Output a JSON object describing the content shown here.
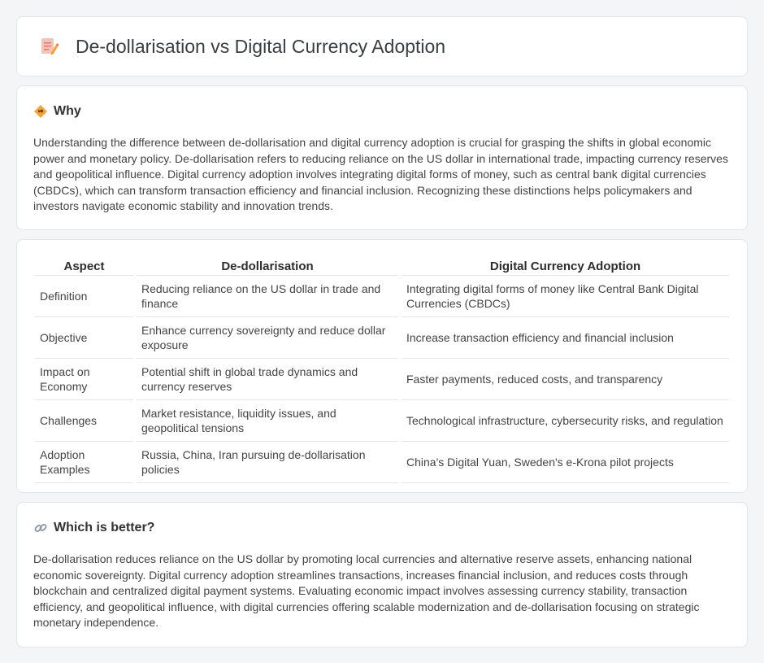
{
  "header": {
    "title": "De-dollarisation vs Digital Currency Adoption",
    "icon": "document-pencil-icon"
  },
  "why": {
    "heading": "Why",
    "icon": "diamond-signpost-icon",
    "text": "Understanding the difference between de-dollarisation and digital currency adoption is crucial for grasping the shifts in global economic power and monetary policy. De-dollarisation refers to reducing reliance on the US dollar in international trade, impacting currency reserves and geopolitical influence. Digital currency adoption involves integrating digital forms of money, such as central bank digital currencies (CBDCs), which can transform transaction efficiency and financial inclusion. Recognizing these distinctions helps policymakers and investors navigate economic stability and innovation trends."
  },
  "table": {
    "headers": [
      "Aspect",
      "De-dollarisation",
      "Digital Currency Adoption"
    ],
    "rows": [
      [
        "Definition",
        "Reducing reliance on the US dollar in trade and finance",
        "Integrating digital forms of money like Central Bank Digital Currencies (CBDCs)"
      ],
      [
        "Objective",
        "Enhance currency sovereignty and reduce dollar exposure",
        "Increase transaction efficiency and financial inclusion"
      ],
      [
        "Impact on Economy",
        "Potential shift in global trade dynamics and currency reserves",
        "Faster payments, reduced costs, and transparency"
      ],
      [
        "Challenges",
        "Market resistance, liquidity issues, and geopolitical tensions",
        "Technological infrastructure, cybersecurity risks, and regulation"
      ],
      [
        "Adoption Examples",
        "Russia, China, Iran pursuing de-dollarisation policies",
        "China's Digital Yuan, Sweden's e-Krona pilot projects"
      ]
    ]
  },
  "better": {
    "heading": "Which is better?",
    "icon": "link-icon",
    "text": "De-dollarisation reduces reliance on the US dollar by promoting local currencies and alternative reserve assets, enhancing national economic sovereignty. Digital currency adoption streamlines transactions, increases financial inclusion, and reduces costs through blockchain and centralized digital payment systems. Evaluating economic impact involves assessing currency stability, transaction efficiency, and geopolitical influence, with digital currencies offering scalable modernization and de-dollarisation focusing on strategic monetary independence."
  }
}
